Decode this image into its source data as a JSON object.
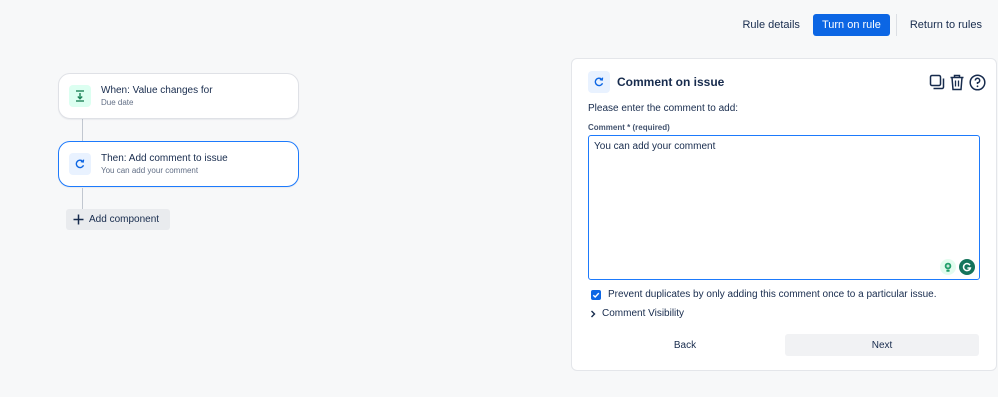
{
  "topbar": {
    "rule_details": "Rule details",
    "turn_on_rule": "Turn on rule",
    "return_to_rules": "Return to rules"
  },
  "flow": {
    "trigger": {
      "title": "When: Value changes for",
      "subtitle": "Due date",
      "icon": "download-arrow-icon"
    },
    "action": {
      "title": "Then: Add comment to issue",
      "subtitle": "You can add your comment",
      "icon": "refresh-icon"
    },
    "add_component": "Add component"
  },
  "panel": {
    "title": "Comment on issue",
    "prompt": "Please enter the comment to add:",
    "field_label": "Comment *",
    "field_required": "(required)",
    "comment_value": "You can add your comment",
    "prevent_duplicates": "Prevent duplicates by only adding this comment once to a particular issue.",
    "prevent_checked": true,
    "comment_visibility": "Comment Visibility",
    "back": "Back",
    "next": "Next"
  },
  "colors": {
    "primary": "#0c66e4",
    "selected_border": "#1d7afc",
    "trigger_icon_bg": "#dcfff1",
    "action_icon_bg": "#e9f2ff"
  }
}
